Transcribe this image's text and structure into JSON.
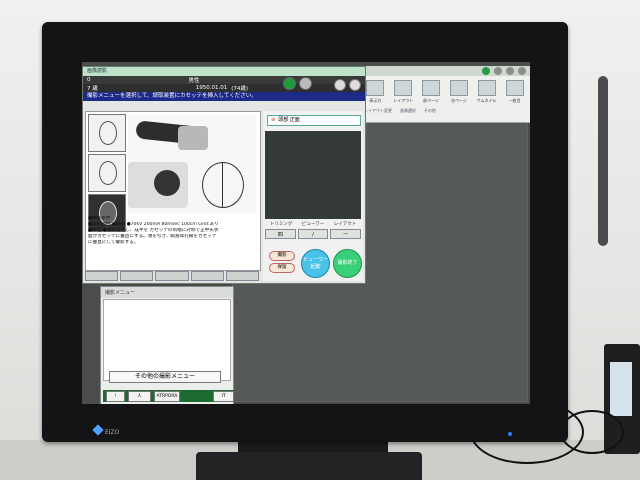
{
  "app": {
    "dialog_title": "画像読影",
    "instruction": "撮影メニューを選択して、読取装置にカセッテを挿入してください。"
  },
  "patient": {
    "id_label": "0",
    "name_label": "7 歳",
    "gender": "男性",
    "dob": "1950.01.01",
    "age": "(74歳)"
  },
  "toolbar": {
    "items": [
      "表示方",
      "レイアウト",
      "前ページ",
      "次ページ",
      "サムネイル",
      "一枚目",
      "撮影プリント"
    ],
    "groups": [
      "レイアウト変更",
      "画像選択",
      "その他"
    ]
  },
  "menu": {
    "selected": "頭部 正面"
  },
  "conditions": {
    "line1": "●撮影条件",
    "line2": "●撮影部位:●頭部 ●70kV 200mA 80msec 100cm Grid:あり",
    "line3": "●体位:●腹臥位とし、成半を カセッテの両端に対称で正中矢状",
    "line4": "面がカセッテに垂直にする。顎を引き、眼窩耳孔線をカセッテ",
    "line5": "に垂直にして撮影する。"
  },
  "panel_right": {
    "tab_row": [
      "トリミング",
      "ビューワー",
      "レイアウト"
    ],
    "ratio_buttons": [
      "四",
      "/",
      "ー"
    ],
    "pill1": "撮影",
    "pill2": "保留",
    "viewer_btn": "ビューワー起動",
    "end_btn": "撮影終了"
  },
  "lower_panel": {
    "title": "撮影メニュー",
    "other_menu": "その他の撮影メニュー",
    "bar": [
      "!",
      "人",
      "ATRPORA",
      "IT"
    ]
  },
  "brand": {
    "logo": "EIZO"
  },
  "colors": {
    "title_bar": "#bfe3c8",
    "instruction_bar": "#1c2a88",
    "accent_green": "#1e9a3e",
    "viewer_btn": "#49c2e8"
  }
}
